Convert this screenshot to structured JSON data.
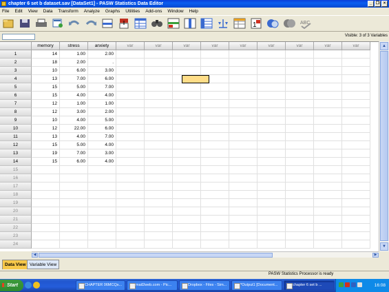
{
  "window": {
    "title": "chapter 6 set b dataset.sav [DataSet1] - PASW Statistics Data Editor"
  },
  "menu": [
    "File",
    "Edit",
    "View",
    "Data",
    "Transform",
    "Analyze",
    "Graphs",
    "Utilities",
    "Add-ons",
    "Window",
    "Help"
  ],
  "toolbar_icons": [
    "open-icon",
    "save-icon",
    "print-icon",
    "dialog-recall-icon",
    "undo-icon",
    "redo-icon",
    "goto-case-icon",
    "goto-variable-icon",
    "variables-icon",
    "find-icon",
    "insert-cases-icon",
    "insert-variable-icon",
    "split-file-icon",
    "weight-cases-icon",
    "select-cases-icon",
    "value-labels-icon",
    "use-sets-icon",
    "show-all-variables-icon",
    "spelling-icon"
  ],
  "visible_label": "Visible: 3 of 3 Variables",
  "columns": [
    "memory",
    "stress",
    "anxiety",
    "var",
    "var",
    "var",
    "var",
    "var",
    "var",
    "var",
    "var",
    "var"
  ],
  "rows": [
    [
      "14",
      "1.00",
      "2.00"
    ],
    [
      "18",
      "2.00",
      "."
    ],
    [
      "10",
      "6.00",
      "3.00"
    ],
    [
      "13",
      "7.00",
      "6.00"
    ],
    [
      "15",
      "5.00",
      "7.00"
    ],
    [
      "15",
      "4.00",
      "4.00"
    ],
    [
      "12",
      "1.00",
      "1.00"
    ],
    [
      "12",
      "3.00",
      "2.00"
    ],
    [
      "10",
      "4.00",
      "5.00"
    ],
    [
      "12",
      "22.00",
      "6.00"
    ],
    [
      "13",
      "4.00",
      "7.00"
    ],
    [
      "15",
      "5.00",
      "4.00"
    ],
    [
      "19",
      "7.00",
      "3.00"
    ],
    [
      "15",
      "6.00",
      "4.00"
    ]
  ],
  "row_numbers": [
    "1",
    "2",
    "3",
    "4",
    "5",
    "6",
    "7",
    "8",
    "9",
    "10",
    "11",
    "12",
    "13",
    "14",
    "15",
    "16",
    "17",
    "18",
    "19",
    "20",
    "21",
    "22",
    "23",
    "24"
  ],
  "tabs": {
    "data_view": "Data View",
    "variable_view": "Variable View"
  },
  "status": "PASW Statistics Processor is ready",
  "taskbar": {
    "start": "Start",
    "items": [
      "CHAPTER 06MCQs...",
      "mail2web.com - Pic...",
      "Dropbox - Files - Sim...",
      "*Output1 [Document...",
      "chapter 6 set b ..."
    ],
    "clock": "16:08"
  }
}
